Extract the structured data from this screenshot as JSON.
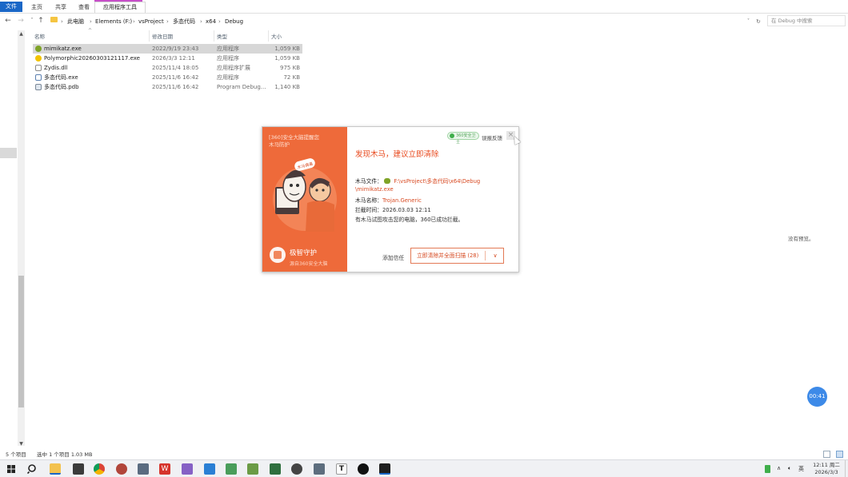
{
  "ribbon": {
    "tabs": [
      {
        "label": "文件"
      },
      {
        "label": "主页"
      },
      {
        "label": "共享"
      },
      {
        "label": "查看"
      },
      {
        "label": "应用程序工具"
      }
    ]
  },
  "address": {
    "crumbs": [
      "此电脑",
      "Elements (F:)",
      "vsProject",
      "多态代码",
      "x64",
      "Debug"
    ],
    "search_placeholder": "在 Debug 中搜索"
  },
  "file_list": {
    "columns": {
      "name": "名称",
      "date": "修改日期",
      "type": "类型",
      "size": "大小"
    },
    "rows": [
      {
        "name": "mimikatz.exe",
        "date": "2022/9/19 23:43",
        "type": "应用程序",
        "size": "1,059 KB",
        "icon": "mimikatz-exe-icon",
        "selected": true
      },
      {
        "name": "Polymorphic20260303121117.exe",
        "date": "2026/3/3 12:11",
        "type": "应用程序",
        "size": "1,059 KB",
        "icon": "polymorphic-exe-icon",
        "selected": false
      },
      {
        "name": "Zydis.dll",
        "date": "2025/11/4 18:05",
        "type": "应用程序扩展",
        "size": "975 KB",
        "icon": "dll-file-icon",
        "selected": false
      },
      {
        "name": "多态代码.exe",
        "date": "2025/11/6 16:42",
        "type": "应用程序",
        "size": "72 KB",
        "icon": "exe-window-icon",
        "selected": false
      },
      {
        "name": "多态代码.pdb",
        "date": "2025/11/6 16:42",
        "type": "Program Debug...",
        "size": "1,140 KB",
        "icon": "pdb-file-icon",
        "selected": false
      }
    ]
  },
  "status_bar": {
    "item_count": "5 个项目",
    "selection": "选中 1 个项目  1.03 MB"
  },
  "preview_pane": {
    "empty_text": "没有预览。"
  },
  "timer_badge": "00:41",
  "alert": {
    "brand": "[360]安全大脑提醒您\n木马防护",
    "mascot_sign": "木马病毒",
    "guard_title": "极智守护",
    "guard_subtitle": "源自360安全大脑",
    "vendor_badge": "360安全卫士",
    "report_link": "误报反馈",
    "headline": "发现木马，建议立即清除",
    "file_label": "木马文件：",
    "file_path_line1": "F:\\vsProject\\多态代码\\x64\\Debug",
    "file_path_line2": "\\mimikatz.exe",
    "name_label": "木马名称：",
    "trojan_name": "Trojan.Generic",
    "time_label": "拦截时间：",
    "time_value": "2026.03.03 12:11",
    "message": "有木马试图攻击您的电脑，360已成功拦截。",
    "trust_link": "添加信任",
    "clean_button": "立即清除并全面扫描 (28)"
  },
  "taskbar": {
    "tray": {
      "input_lang": "英",
      "clock_time": "12:11 周二",
      "clock_date": "2026/3/3"
    },
    "accent": "#1a67c7"
  }
}
